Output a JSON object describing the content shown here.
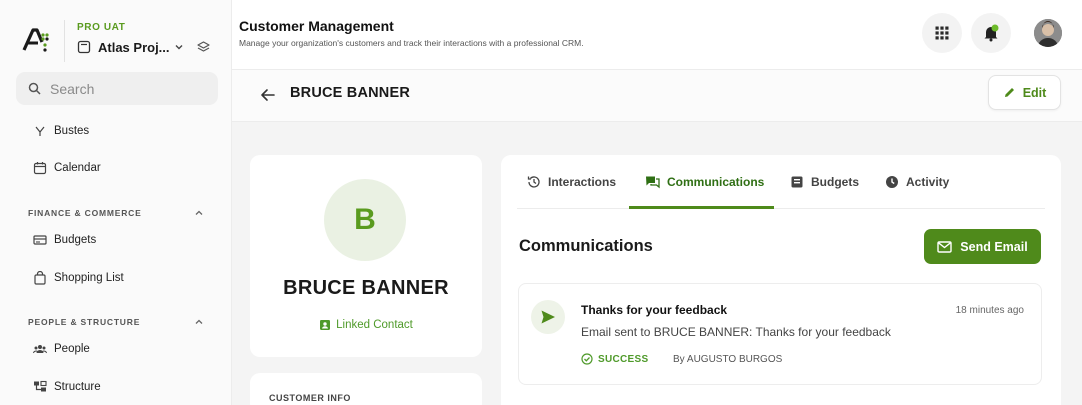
{
  "colors": {
    "accent": "#4f8a1b",
    "accent_light": "#eaf1e3",
    "text": "#1a1a1a"
  },
  "sidebar": {
    "env_label": "PRO UAT",
    "project_name": "Atlas Proj...",
    "search_placeholder": "Search",
    "items": [
      {
        "label": "Bustes",
        "icon": "filter-icon"
      },
      {
        "label": "Calendar",
        "icon": "calendar-icon"
      }
    ],
    "sections": [
      {
        "title": "FINANCE & COMMERCE",
        "items": [
          {
            "label": "Budgets",
            "icon": "budget-icon"
          },
          {
            "label": "Shopping List",
            "icon": "shopping-bag-icon"
          }
        ]
      },
      {
        "title": "PEOPLE & STRUCTURE",
        "items": [
          {
            "label": "People",
            "icon": "people-icon"
          },
          {
            "label": "Structure",
            "icon": "structure-icon"
          }
        ]
      }
    ]
  },
  "header": {
    "title": "Customer Management",
    "subtitle": "Manage your organization's customers and track their interactions with a professional CRM."
  },
  "page": {
    "customer_name": "BRUCE BANNER",
    "edit_label": "Edit"
  },
  "profile": {
    "initial": "B",
    "name": "BRUCE BANNER",
    "linked_label": "Linked Contact",
    "info_title": "CUSTOMER INFO"
  },
  "tabs": [
    {
      "label": "Interactions",
      "icon": "history-icon",
      "active": false
    },
    {
      "label": "Communications",
      "icon": "chat-icon",
      "active": true
    },
    {
      "label": "Budgets",
      "icon": "budget-icon",
      "active": false
    },
    {
      "label": "Activity",
      "icon": "activity-icon",
      "active": false
    }
  ],
  "communications": {
    "title": "Communications",
    "send_label": "Send Email",
    "messages": [
      {
        "subject": "Thanks for your feedback",
        "time": "18 minutes ago",
        "body": "Email sent to BRUCE BANNER: Thanks for your feedback",
        "status": "SUCCESS",
        "by": "By AUGUSTO BURGOS"
      }
    ]
  }
}
